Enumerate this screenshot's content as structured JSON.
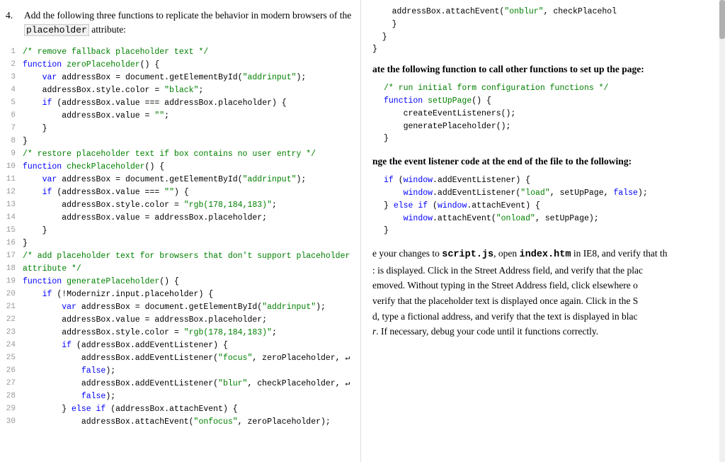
{
  "left": {
    "step": {
      "number": "4.",
      "text": "Add the following three functions to replicate the behavior in modern browsers of the",
      "code_word": "placeholder",
      "text2": "attribute:"
    },
    "lines": [
      {
        "num": "1",
        "tokens": [
          {
            "type": "cm",
            "text": "/* remove fallback placeholder text */"
          }
        ]
      },
      {
        "num": "2",
        "tokens": [
          {
            "type": "kw",
            "text": "function"
          },
          {
            "type": "plain",
            "text": " "
          },
          {
            "type": "fn-def",
            "text": "zeroPlaceholder"
          },
          {
            "type": "plain",
            "text": "() {"
          }
        ]
      },
      {
        "num": "3",
        "tokens": [
          {
            "type": "plain",
            "text": "    "
          },
          {
            "type": "kw",
            "text": "var"
          },
          {
            "type": "plain",
            "text": " addressBox "
          },
          {
            "type": "op",
            "text": "="
          },
          {
            "type": "plain",
            "text": " document.getElementById("
          },
          {
            "type": "str",
            "text": "\"addrinput\""
          },
          {
            "type": "plain",
            "text": ");"
          }
        ]
      },
      {
        "num": "4",
        "tokens": [
          {
            "type": "plain",
            "text": "    addressBox.style.color "
          },
          {
            "type": "op",
            "text": "="
          },
          {
            "type": "plain",
            "text": " "
          },
          {
            "type": "str",
            "text": "\"black\""
          },
          {
            "type": "plain",
            "text": ";"
          }
        ]
      },
      {
        "num": "5",
        "tokens": [
          {
            "type": "plain",
            "text": "    "
          },
          {
            "type": "kw",
            "text": "if"
          },
          {
            "type": "plain",
            "text": " (addressBox.value "
          },
          {
            "type": "op",
            "text": "==="
          },
          {
            "type": "plain",
            "text": " addressBox.placeholder) {"
          }
        ]
      },
      {
        "num": "6",
        "tokens": [
          {
            "type": "plain",
            "text": "        addressBox.value "
          },
          {
            "type": "op",
            "text": "="
          },
          {
            "type": "plain",
            "text": " "
          },
          {
            "type": "str",
            "text": "\"\""
          },
          {
            "type": "plain",
            "text": ";"
          }
        ]
      },
      {
        "num": "7",
        "tokens": [
          {
            "type": "plain",
            "text": "    }"
          }
        ]
      },
      {
        "num": "8",
        "tokens": [
          {
            "type": "plain",
            "text": "}"
          }
        ]
      },
      {
        "num": "9",
        "tokens": [
          {
            "type": "cm",
            "text": "/* restore placeholder text if box contains no user entry */"
          }
        ]
      },
      {
        "num": "10",
        "tokens": [
          {
            "type": "kw",
            "text": "function"
          },
          {
            "type": "plain",
            "text": " "
          },
          {
            "type": "fn-def",
            "text": "checkPlaceholder"
          },
          {
            "type": "plain",
            "text": "() {"
          }
        ]
      },
      {
        "num": "11",
        "tokens": [
          {
            "type": "plain",
            "text": "    "
          },
          {
            "type": "kw",
            "text": "var"
          },
          {
            "type": "plain",
            "text": " addressBox "
          },
          {
            "type": "op",
            "text": "="
          },
          {
            "type": "plain",
            "text": " document.getElementById("
          },
          {
            "type": "str",
            "text": "\"addrinput\""
          },
          {
            "type": "plain",
            "text": ");"
          }
        ]
      },
      {
        "num": "12",
        "tokens": [
          {
            "type": "plain",
            "text": "    "
          },
          {
            "type": "kw",
            "text": "if"
          },
          {
            "type": "plain",
            "text": " (addressBox.value "
          },
          {
            "type": "op",
            "text": "==="
          },
          {
            "type": "plain",
            "text": " "
          },
          {
            "type": "str",
            "text": "\"\""
          },
          {
            "type": "plain",
            "text": ") {"
          }
        ]
      },
      {
        "num": "13",
        "tokens": [
          {
            "type": "plain",
            "text": "        addressBox.style.color "
          },
          {
            "type": "op",
            "text": "="
          },
          {
            "type": "plain",
            "text": " "
          },
          {
            "type": "str",
            "text": "\"rgb(178,184,183)\""
          },
          {
            "type": "plain",
            "text": ";"
          }
        ]
      },
      {
        "num": "14",
        "tokens": [
          {
            "type": "plain",
            "text": "        addressBox.value "
          },
          {
            "type": "op",
            "text": "="
          },
          {
            "type": "plain",
            "text": " addressBox.placeholder;"
          }
        ]
      },
      {
        "num": "15",
        "tokens": [
          {
            "type": "plain",
            "text": "    }"
          }
        ]
      },
      {
        "num": "16",
        "tokens": [
          {
            "type": "plain",
            "text": "}"
          }
        ]
      },
      {
        "num": "17",
        "tokens": [
          {
            "type": "cm",
            "text": "/* add placeholder text for browsers that don't support placeholder"
          }
        ]
      },
      {
        "num": "18",
        "tokens": [
          {
            "type": "cm",
            "text": "attribute */"
          }
        ]
      },
      {
        "num": "19",
        "tokens": [
          {
            "type": "kw",
            "text": "function"
          },
          {
            "type": "plain",
            "text": " "
          },
          {
            "type": "fn-def",
            "text": "generatePlaceholder"
          },
          {
            "type": "plain",
            "text": "() {"
          }
        ]
      },
      {
        "num": "20",
        "tokens": [
          {
            "type": "plain",
            "text": "    "
          },
          {
            "type": "kw",
            "text": "if"
          },
          {
            "type": "plain",
            "text": " (!Modernizr.input.placeholder) {"
          }
        ]
      },
      {
        "num": "21",
        "tokens": [
          {
            "type": "plain",
            "text": "        "
          },
          {
            "type": "kw",
            "text": "var"
          },
          {
            "type": "plain",
            "text": " addressBox "
          },
          {
            "type": "op",
            "text": "="
          },
          {
            "type": "plain",
            "text": " document.getElementById("
          },
          {
            "type": "str",
            "text": "\"addrinput\""
          },
          {
            "type": "plain",
            "text": ");"
          }
        ]
      },
      {
        "num": "22",
        "tokens": [
          {
            "type": "plain",
            "text": "        addressBox.value "
          },
          {
            "type": "op",
            "text": "="
          },
          {
            "type": "plain",
            "text": " addressBox.placeholder;"
          }
        ]
      },
      {
        "num": "23",
        "tokens": [
          {
            "type": "plain",
            "text": "        addressBox.style.color "
          },
          {
            "type": "op",
            "text": "="
          },
          {
            "type": "plain",
            "text": " "
          },
          {
            "type": "str",
            "text": "\"rgb(178,184,183)\""
          },
          {
            "type": "plain",
            "text": ";"
          }
        ]
      },
      {
        "num": "24",
        "tokens": [
          {
            "type": "plain",
            "text": "        "
          },
          {
            "type": "kw",
            "text": "if"
          },
          {
            "type": "plain",
            "text": " (addressBox.addEventListener) {"
          }
        ]
      },
      {
        "num": "25",
        "tokens": [
          {
            "type": "plain",
            "text": "            addressBox.addEventListener("
          },
          {
            "type": "str",
            "text": "\"focus\""
          },
          {
            "type": "plain",
            "text": ", zeroPlaceholder, ↵"
          }
        ]
      },
      {
        "num": "26",
        "tokens": [
          {
            "type": "plain",
            "text": "            "
          },
          {
            "type": "kw",
            "text": "false"
          },
          {
            "type": "plain",
            "text": ");"
          }
        ]
      },
      {
        "num": "27",
        "tokens": [
          {
            "type": "plain",
            "text": "            addressBox.addEventListener("
          },
          {
            "type": "str",
            "text": "\"blur\""
          },
          {
            "type": "plain",
            "text": ", checkPlaceholder, ↵"
          }
        ]
      },
      {
        "num": "28",
        "tokens": [
          {
            "type": "plain",
            "text": "            "
          },
          {
            "type": "kw",
            "text": "false"
          },
          {
            "type": "plain",
            "text": ");"
          }
        ]
      },
      {
        "num": "29",
        "tokens": [
          {
            "type": "plain",
            "text": "        } "
          },
          {
            "type": "kw",
            "text": "else"
          },
          {
            "type": "plain",
            "text": " "
          },
          {
            "type": "kw",
            "text": "if"
          },
          {
            "type": "plain",
            "text": " (addressBox.attachEvent) {"
          }
        ]
      },
      {
        "num": "30",
        "tokens": [
          {
            "type": "plain",
            "text": "            addressBox.attachEvent("
          },
          {
            "type": "str",
            "text": "\"onfocus\""
          },
          {
            "type": "plain",
            "text": ", zeroPlaceholder);"
          }
        ]
      }
    ]
  },
  "right": {
    "top_code": [
      "    addressBox.attachEvent(\"onblur\", checkPlacehol",
      "    }",
      "  }",
      "}"
    ],
    "section2_heading": "ate the following function to call other functions to set up the page:",
    "section2_code": [
      "/* run initial form configuration functions */",
      "function setUpPage() {",
      "    createEventListeners();",
      "    generatePlaceholder();",
      "}"
    ],
    "section3_heading": "nge the event listener code at the end of the file to the following:",
    "section3_code": [
      "if (window.addEventListener) {",
      "    window.addEventListener(\"load\", setUpPage, false);",
      "} else if (window.attachEvent) {",
      "    window.attachEvent(\"onload\", setUpPage);",
      "}"
    ],
    "prose": "e your changes to script.js, open index.htm in IE8, and verify that th",
    "prose2": ": is displayed. Click in the Street Address field, and verify that the plac",
    "prose3": "emoved. Without typing in the Street Address field, click elsewhere o",
    "prose4": "verify that the placeholder text is displayed once again. Click in the S",
    "prose5": "d, type a fictional address, and verify that the text is displayed in blac",
    "prose6": "r. If necessary, debug your code until it functions correctly.",
    "inline_codes": [
      "script.js",
      "index.htm"
    ]
  }
}
